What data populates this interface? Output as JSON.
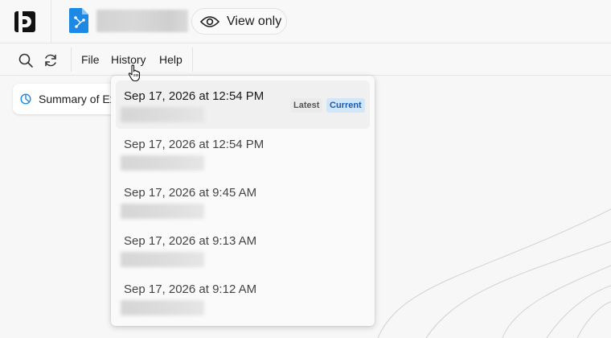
{
  "header": {
    "view_only_label": "View only"
  },
  "toolbar": {
    "menu": [
      {
        "label": "File"
      },
      {
        "label": "History"
      },
      {
        "label": "Help"
      }
    ]
  },
  "sidebar": {
    "summary_chip_label": "Summary of Ex"
  },
  "history_menu": {
    "items": [
      {
        "date": "Sep 17, 2026 at 12:54 PM",
        "badges": [
          "Latest",
          "Current"
        ]
      },
      {
        "date": "Sep 17, 2026 at 12:54 PM",
        "badges": []
      },
      {
        "date": "Sep 17, 2026 at 9:45 AM",
        "badges": []
      },
      {
        "date": "Sep 17, 2026 at 9:13 AM",
        "badges": []
      },
      {
        "date": "Sep 17, 2026 at 9:12 AM",
        "badges": []
      }
    ],
    "badge_latest": "Latest",
    "badge_current": "Current"
  },
  "colors": {
    "accent": "#1e88e5",
    "current_badge_bg": "#d2e6fa",
    "current_badge_text": "#1a5aa6"
  },
  "icons": [
    "app-logo-icon",
    "diagram-file-icon",
    "eye-icon",
    "search-icon",
    "refresh-icon",
    "chart-icon",
    "hand-cursor-icon"
  ]
}
